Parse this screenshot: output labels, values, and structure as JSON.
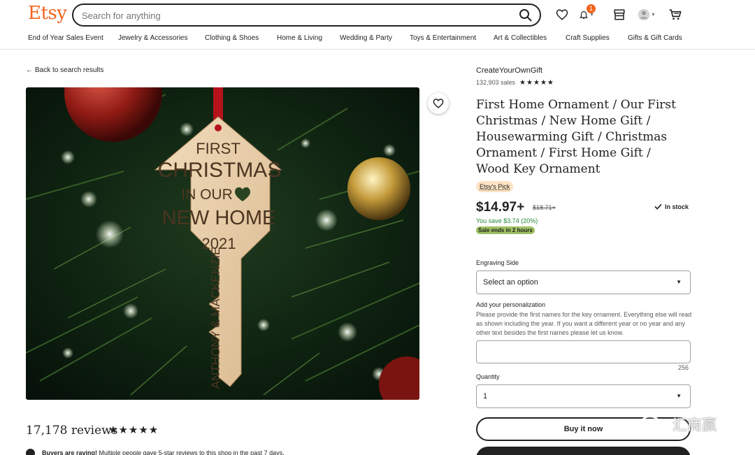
{
  "header": {
    "logo": "Etsy",
    "search_placeholder": "Search for anything",
    "cart_badge": "1"
  },
  "categories": [
    "End of Year Sales Event",
    "Jewelry & Accessories",
    "Clothing & Shoes",
    "Home & Living",
    "Wedding & Party",
    "Toys & Entertainment",
    "Art & Collectibles",
    "Craft Supplies",
    "Gifts & Gift Cards"
  ],
  "back_link": "Back to search results",
  "product_image": {
    "line1": "FIRST",
    "line2": "CHRISTMAS",
    "line3": "IN OUR",
    "line4": "NEW HOME",
    "year": "2021",
    "names": "ANTHONY & MACKENZIE"
  },
  "reviews": {
    "count": "17,178 reviews",
    "stars": "★★★★★",
    "raving_bold": "Buyers are raving!",
    "raving_text": " Multiple people gave 5-star reviews to this shop in the past 7 days."
  },
  "shop": {
    "name": "CreateYourOwnGift",
    "sales": "132,903 sales",
    "stars": "★★★★★"
  },
  "listing": {
    "title": "First Home Ornament / Our First Christmas / New Home Gift / Housewarming Gift / Christmas Ornament / First Home Gift / Wood Key Ornament",
    "pick": "Etsy's Pick",
    "price": "$14.97+",
    "old_price": "$18.71+",
    "stock": "In stock",
    "save": "You save $3.74 (20%)",
    "sale_ends": "Sale ends in 2 hours"
  },
  "form": {
    "engraving_label": "Engraving Side",
    "engraving_value": "Select an option",
    "personalization_label": "Add your personalization",
    "personalization_text": "Please provide the first names for the key ornament. Everything else will read as shown including the year. If you want a different year or no year and any other text besides the first names please let us know.",
    "char_count": "256",
    "quantity_label": "Quantity",
    "quantity_value": "1",
    "buy_now": "Buy it now"
  },
  "watermark": "汇商赢",
  "colors": {
    "brand": "#f1641e",
    "sale_green": "#258635",
    "sale_badge": "#9ec063",
    "pick_badge": "#fde3c4"
  },
  "icons": [
    "search-icon",
    "heart-icon",
    "bell-icon",
    "shop-icon",
    "user-icon",
    "cart-icon",
    "arrow-left-icon",
    "check-icon",
    "chevron-down-icon"
  ]
}
